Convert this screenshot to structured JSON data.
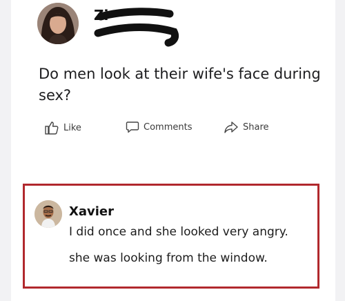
{
  "post": {
    "author_visible": "Zi",
    "text": "Do men look at their wife's face during sex?"
  },
  "actions": {
    "like_label": "Like",
    "comments_label": "Comments",
    "share_label": "Share"
  },
  "comment": {
    "author": "Xavier",
    "line1": "I did once and she looked very angry.",
    "line2": "she was looking from the window."
  },
  "colors": {
    "highlight_border": "#b1282d",
    "background": "#ffffff"
  },
  "icons": {
    "like": "thumbs-up-icon",
    "comments": "comment-bubble-icon",
    "share": "share-arrow-icon"
  }
}
